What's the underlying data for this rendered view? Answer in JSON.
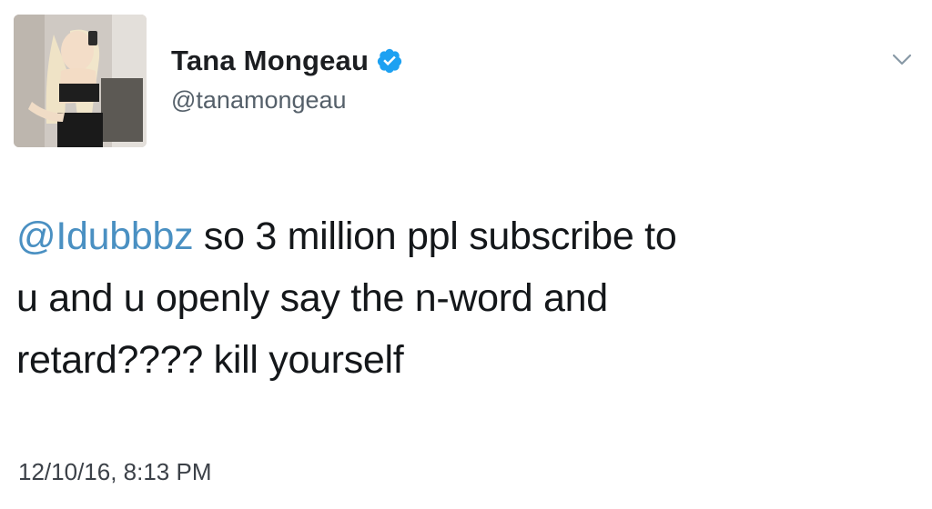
{
  "tweet": {
    "author": {
      "display_name": "Tana Mongeau",
      "handle": "@tanamongeau",
      "verified": true,
      "verified_color": "#1da1f2",
      "avatar_icon": "profile-photo"
    },
    "menu_icon": "chevron-down-icon",
    "text": {
      "mention": "@Idubbbz",
      "line1_rest": " so 3 million ppl subscribe to",
      "line2": "u and u openly say the n-word and",
      "line3": "retard???? kill yourself"
    },
    "timestamp": "12/10/16, 8:13 PM",
    "colors": {
      "mention": "#4a90c2",
      "text": "#14171a",
      "secondary": "#55606a"
    }
  }
}
